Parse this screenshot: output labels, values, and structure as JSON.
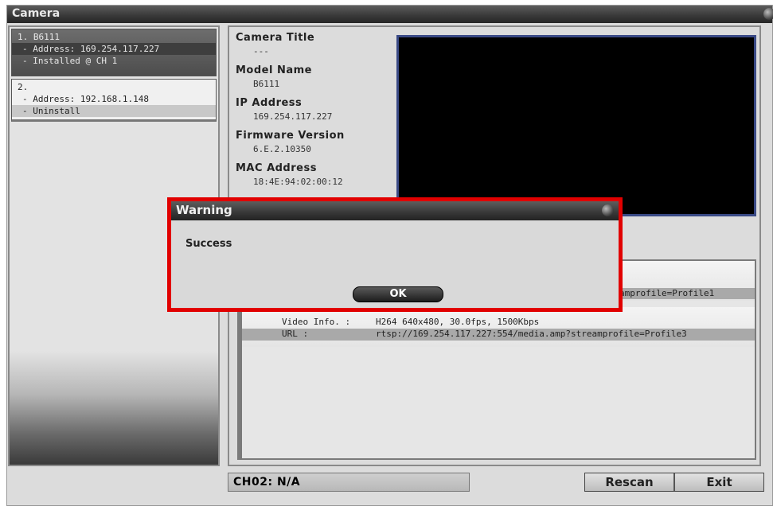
{
  "window": {
    "title": "Camera"
  },
  "cameras": [
    {
      "header": "1. B6111",
      "address": "- Address: 169.254.117.227",
      "status": "- Installed @ CH 1"
    },
    {
      "header": "2.",
      "address": "- Address: 192.168.1.148",
      "status": "- Uninstall"
    }
  ],
  "info": {
    "camera_title_label": "Camera Title",
    "camera_title_value": "---",
    "model_name_label": "Model Name",
    "model_name_value": "B6111",
    "ip_label": "IP Address",
    "ip_value": "169.254.117.227",
    "firmware_label": "Firmware Version",
    "firmware_value": "6.E.2.10350",
    "mac_label": "MAC Address",
    "mac_value": "18:4E:94:02:00:12"
  },
  "streams": [
    {
      "url_tail": "amprofile=Profile1"
    },
    {
      "video_info_label": "Video Info. :",
      "video_info_value": "H264 640x480, 30.0fps, 1500Kbps",
      "url_label": "URL :",
      "url_value": "rtsp://169.254.117.227:554/media.amp?streamprofile=Profile3"
    }
  ],
  "status": {
    "channel": "CH02: N/A"
  },
  "buttons": {
    "rescan": "Rescan",
    "exit": "Exit"
  },
  "dialog": {
    "title": "Warning",
    "message": "Success",
    "ok": "OK"
  },
  "colors": {
    "alert_frame": "#e10000",
    "preview_border": "#3a4a86"
  }
}
